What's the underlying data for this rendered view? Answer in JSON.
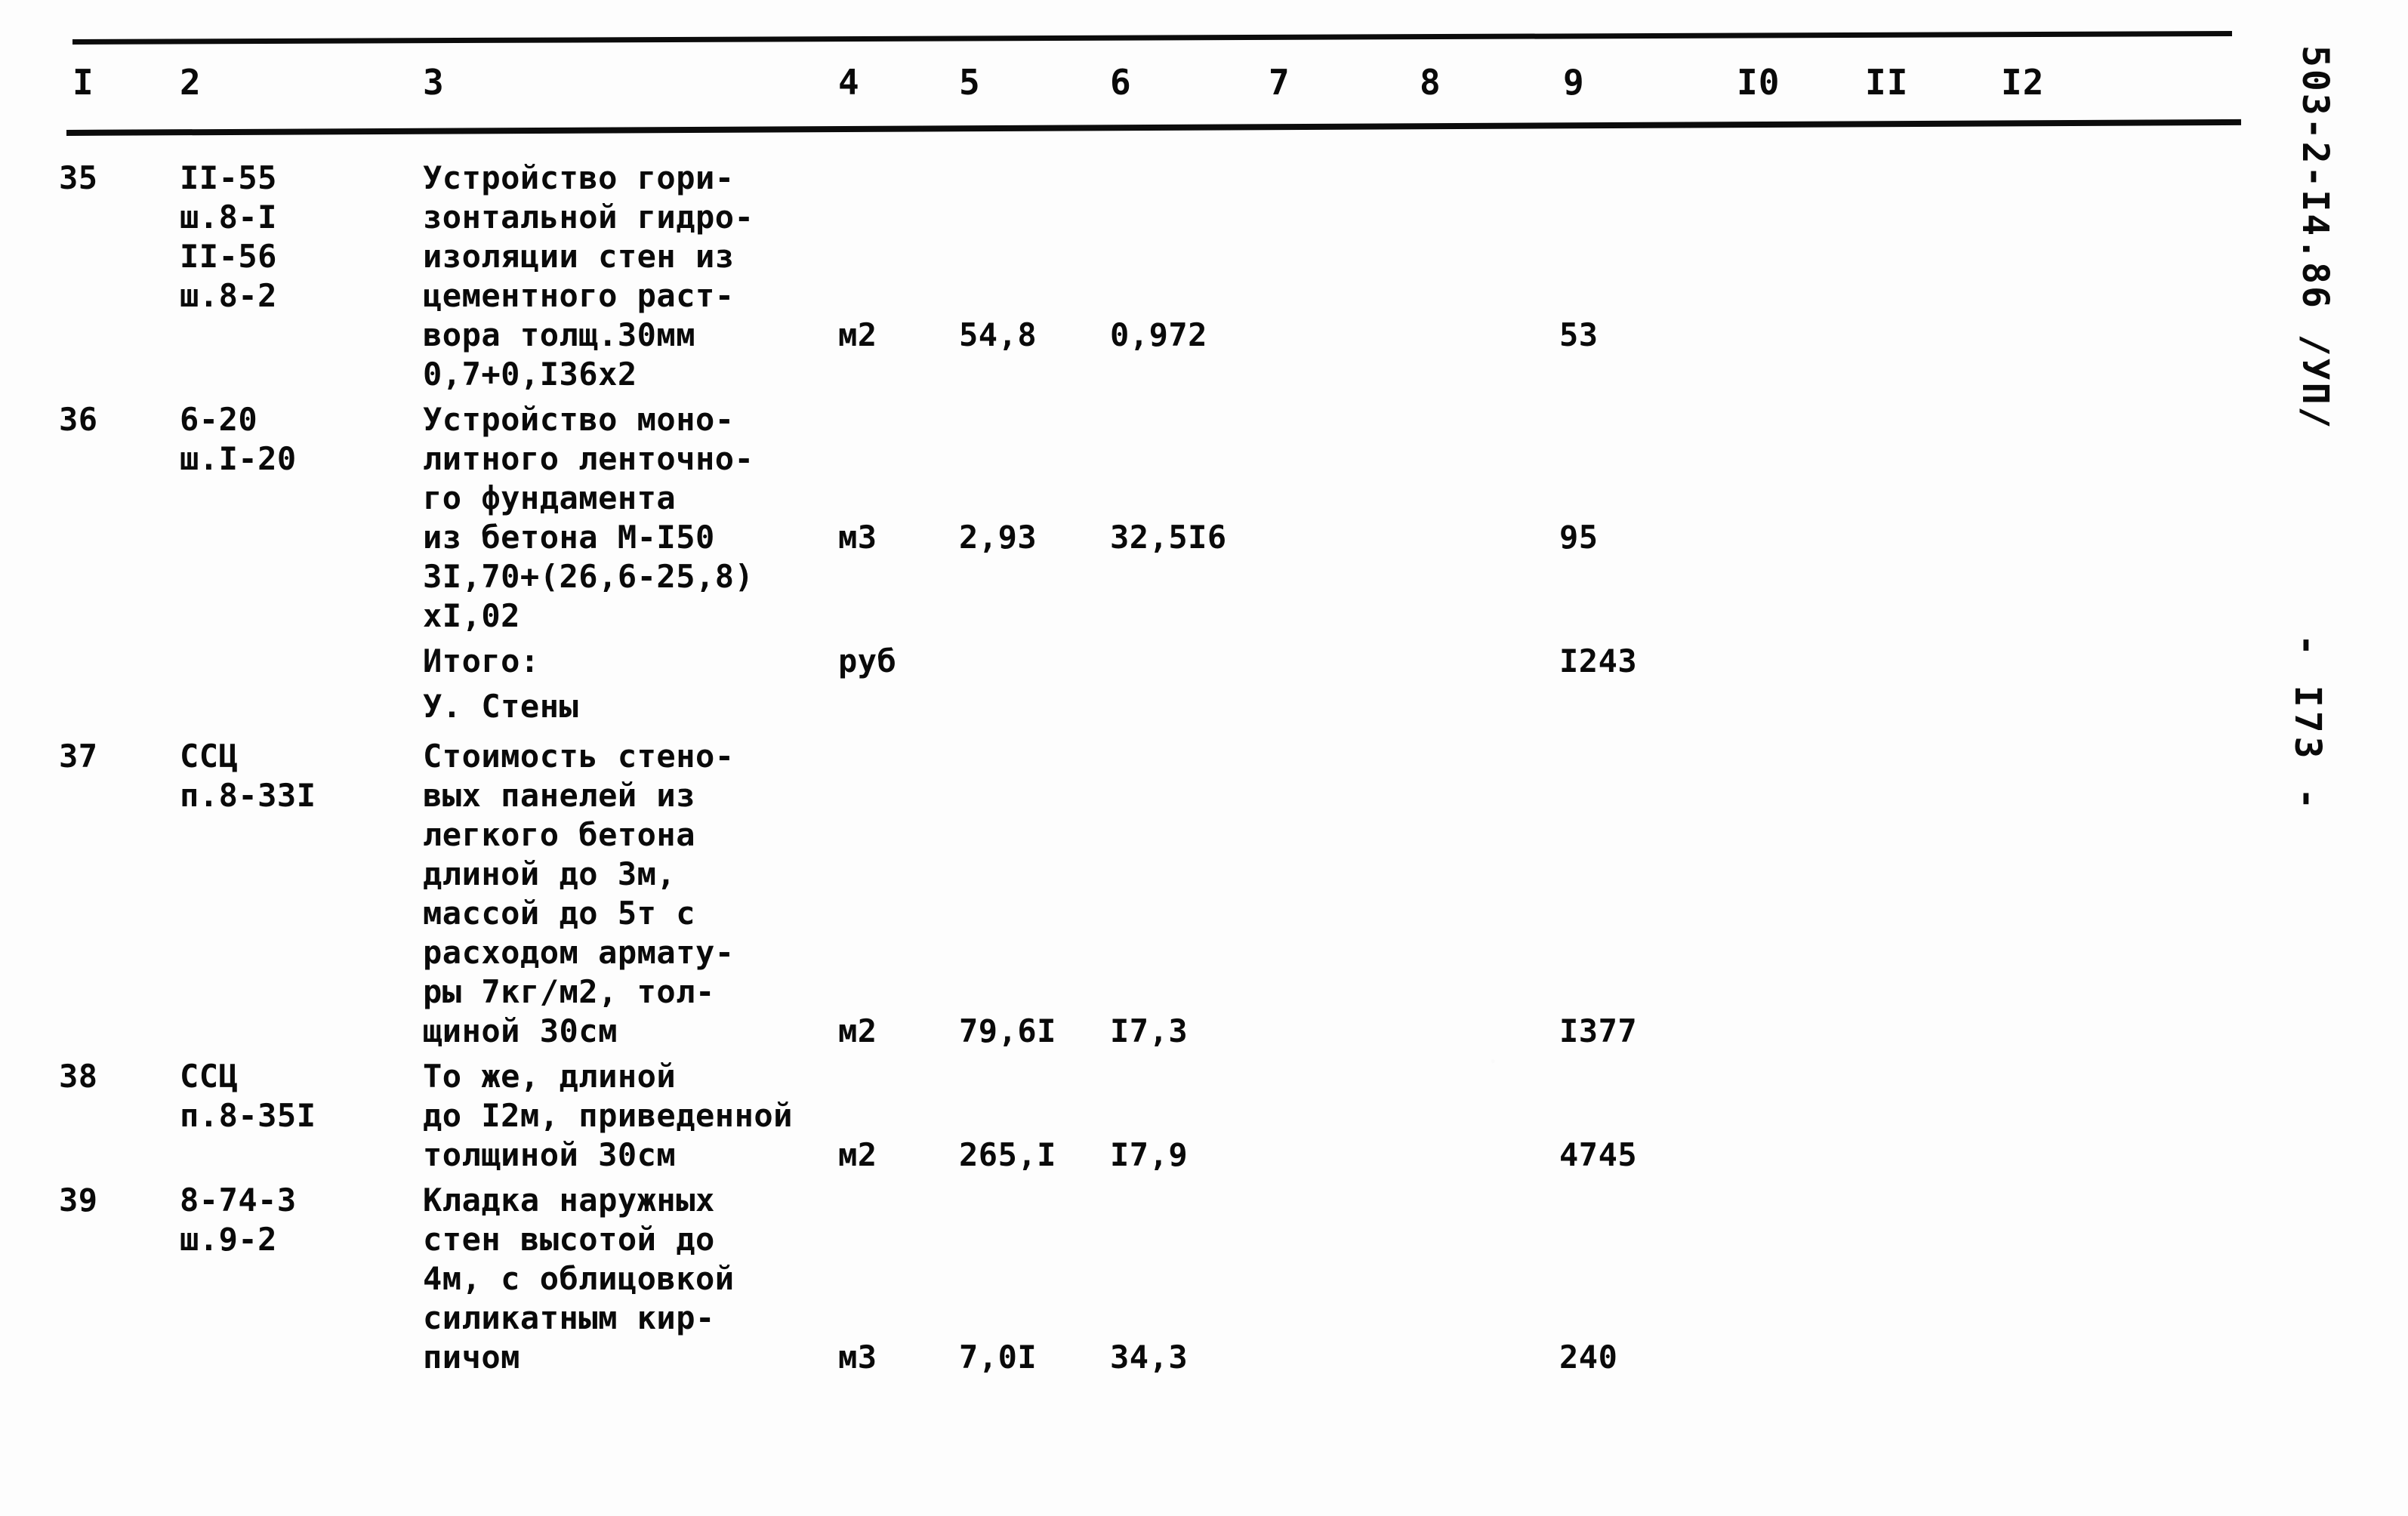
{
  "document": {
    "code": "503-2-I4.86 /УП/",
    "page_marker": "- I73 -"
  },
  "table": {
    "column_headers": [
      "I",
      "2",
      "3",
      "4",
      "5",
      "6",
      "7",
      "8",
      "9",
      "I0",
      "II",
      "I2"
    ],
    "rows": [
      {
        "kind": "item",
        "num": "35",
        "code": "II-55\nш.8-I\nII-56\nш.8-2",
        "description": "Устройство гори-\nзонтальной гидро-\nизоляции стен из\nцементного раст-\nвора толщ.30мм\n0,7+0,I36х2",
        "unit": "м2",
        "qty": "54,8",
        "price": "0,972",
        "col7": "",
        "col8": "",
        "total": "53",
        "col10": "",
        "col11": "",
        "col12": "",
        "value_line_index": 4
      },
      {
        "kind": "item",
        "num": "36",
        "code": "6-20\nш.I-20",
        "description": "Устройство моно-\nлитного ленточно-\nго фундамента\nиз бетона М-I50\n3I,70+(26,6-25,8)\nхI,02",
        "unit": "м3",
        "qty": "2,93",
        "price": "32,5I6",
        "col7": "",
        "col8": "",
        "total": "95",
        "col10": "",
        "col11": "",
        "col12": "",
        "value_line_index": 3
      },
      {
        "kind": "total",
        "num": "",
        "code": "",
        "description": "Итого:",
        "unit": "руб",
        "qty": "",
        "price": "",
        "col7": "",
        "col8": "",
        "total": "I243",
        "col10": "",
        "col11": "",
        "col12": "",
        "value_line_index": 0
      },
      {
        "kind": "section",
        "num": "",
        "code": "",
        "description": "У. Стены",
        "unit": "",
        "qty": "",
        "price": "",
        "col7": "",
        "col8": "",
        "total": "",
        "col10": "",
        "col11": "",
        "col12": "",
        "value_line_index": 0
      },
      {
        "kind": "item",
        "num": "37",
        "code": "ССЦ\nп.8-33I",
        "description": "Стоимость стено-\nвых панелей из\nлегкого бетона\nдлиной до 3м,\nмассой до 5т с\nрасходом армату-\nры 7кг/м2, тол-\nщиной 30см",
        "unit": "м2",
        "qty": "79,6I",
        "price": "I7,3",
        "col7": "",
        "col8": "",
        "total": "I377",
        "col10": "",
        "col11": "",
        "col12": "",
        "value_line_index": 7
      },
      {
        "kind": "item",
        "num": "38",
        "code": "ССЦ\nп.8-35I",
        "description": "То же, длиной\nдо I2м, приведенной\nтолщиной 30см",
        "unit": "м2",
        "qty": "265,I",
        "price": "I7,9",
        "col7": "",
        "col8": "",
        "total": "4745",
        "col10": "",
        "col11": "",
        "col12": "",
        "value_line_index": 2
      },
      {
        "kind": "item",
        "num": "39",
        "code": "8-74-3\nш.9-2",
        "description": "Кладка наружных\nстен высотой до\n4м, с облицовкой\nсиликатным кир-\nпичом",
        "unit": "м3",
        "qty": "7,0I",
        "price": "34,3",
        "col7": "",
        "col8": "",
        "total": "240",
        "col10": "",
        "col11": "",
        "col12": "",
        "value_line_index": 4
      }
    ]
  }
}
